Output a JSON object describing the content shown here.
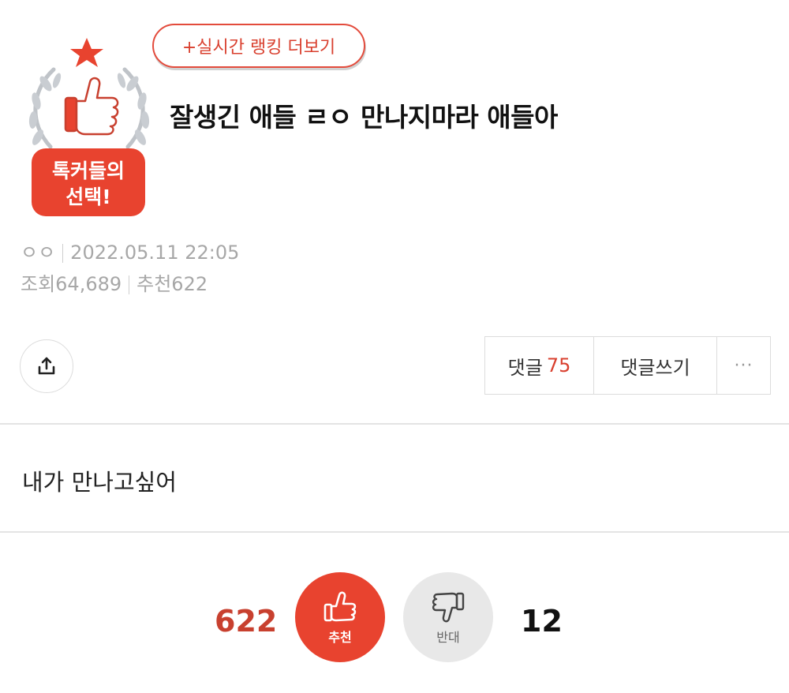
{
  "badge": {
    "line1": "톡커들의",
    "line2": "선택!"
  },
  "ranking_link": "+실시간 랭킹 더보기",
  "post": {
    "title": "잘생긴 애들 ㄹㅇ 만나지마라 애들아",
    "author": "ㅇㅇ",
    "datetime": "2022.05.11 22:05",
    "views_label": "조회64,689",
    "recommend_label": "추천622",
    "body": "내가 만나고싶어"
  },
  "toolbar": {
    "comments_label": "댓글",
    "comments_count": "75",
    "write_comment_label": "댓글쓰기",
    "more_label": "···"
  },
  "votes": {
    "up_count": "622",
    "up_label": "추천",
    "down_label": "반대",
    "down_count": "12"
  },
  "colors": {
    "accent": "#e8432f",
    "muted": "#a7a7a7",
    "border": "#dcdcdc"
  },
  "icons": [
    "laurel-badge-icon",
    "star-icon",
    "thumbs-up-icon",
    "thumbs-down-icon",
    "share-icon",
    "more-dots-icon"
  ]
}
